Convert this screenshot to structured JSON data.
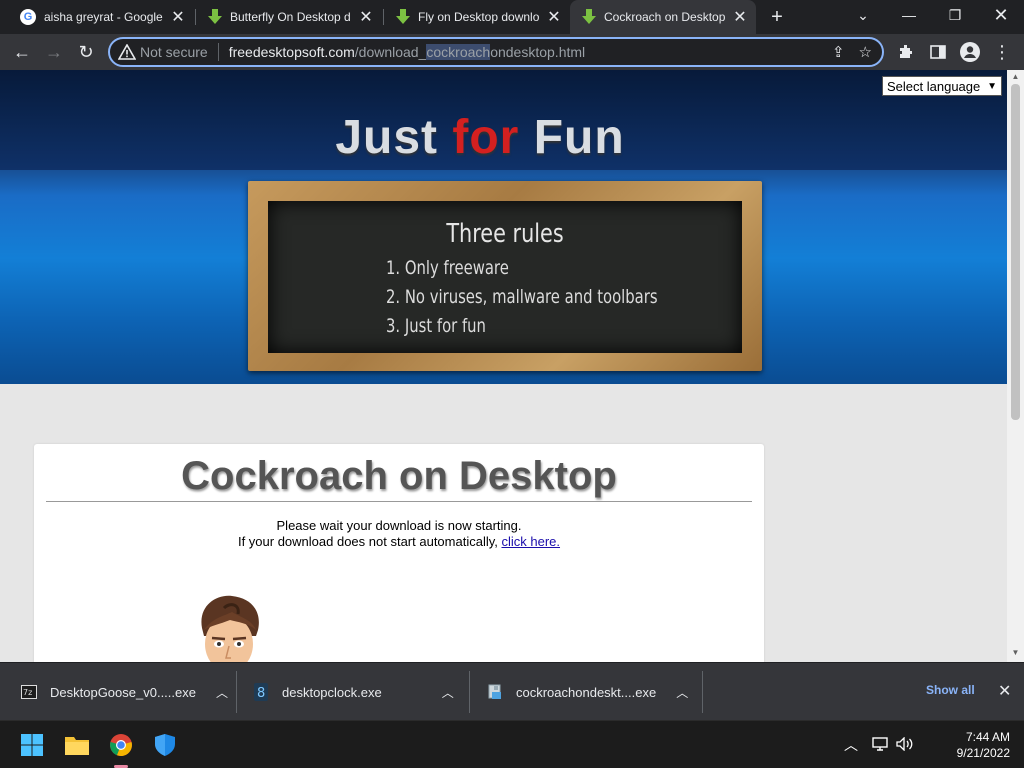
{
  "tabs": [
    {
      "title": "aisha greyrat - Google",
      "icon": "google-g-icon",
      "active": false
    },
    {
      "title": "Butterfly On Desktop d",
      "icon": "download-arrow-icon",
      "active": false
    },
    {
      "title": "Fly on Desktop downlo",
      "icon": "download-arrow-icon",
      "active": false
    },
    {
      "title": "Cockroach on Desktop",
      "icon": "download-arrow-icon",
      "active": true
    }
  ],
  "omnibox": {
    "security_label": "Not secure",
    "url_host": "freedesktopsoft.com",
    "url_path_before": "/download_",
    "url_path_selected": "cockroach",
    "url_path_after": "ondesktop.html"
  },
  "page": {
    "language_select": "Select language",
    "site_title": {
      "part1": "Just",
      "part2": "for",
      "part3": "Fun"
    },
    "rules_title": "Three rules",
    "rules": [
      "1. Only freeware",
      "2. No viruses, mallware and toolbars",
      "3. Just for fun"
    ],
    "heading": "Cockroach on Desktop",
    "wait_text": "Please wait your download is now starting.",
    "fallback_text": "If your download does not start automatically, ",
    "fallback_link": "click here."
  },
  "downloads": {
    "items": [
      {
        "name": "DesktopGoose_v0.....exe",
        "icon": "archive-icon"
      },
      {
        "name": "desktopclock.exe",
        "icon": "clock-app-icon"
      },
      {
        "name": "cockroachondeskt....exe",
        "icon": "installer-icon"
      }
    ],
    "show_all": "Show all"
  },
  "taskbar": {
    "time": "7:44 AM",
    "date": "9/21/2022"
  },
  "colors": {
    "accent": "#8ab4f8",
    "title_red": "#d32020",
    "chrome_dark": "#202124",
    "chrome_toolbar": "#35363a"
  }
}
